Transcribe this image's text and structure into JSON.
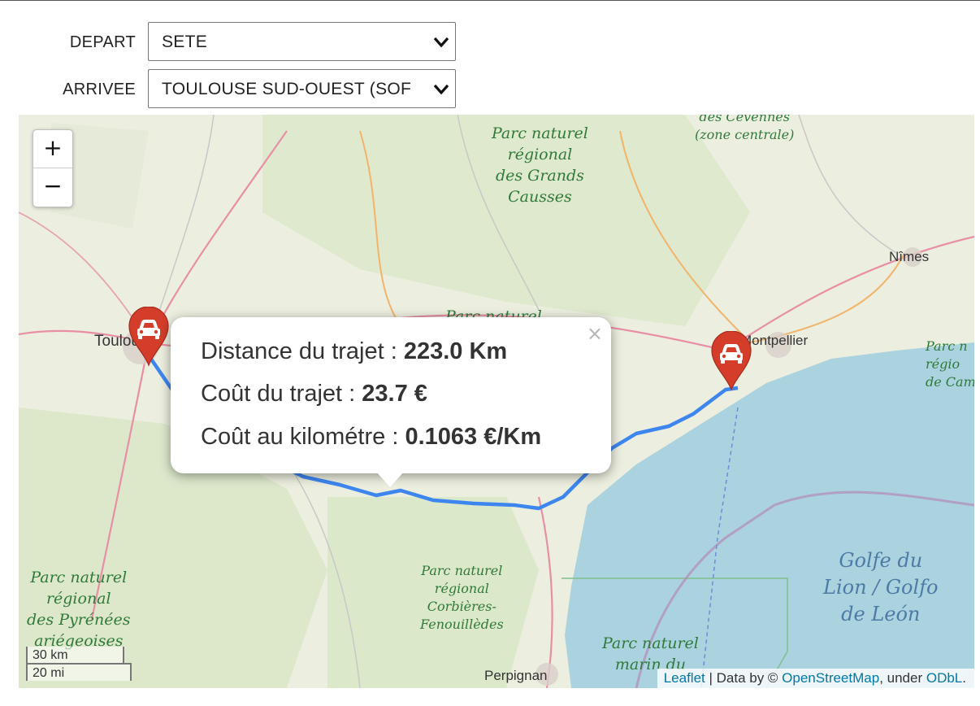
{
  "form": {
    "depart_label": "DEPART",
    "depart_value": "SETE",
    "arrivee_label": "ARRIVEE",
    "arrivee_value": "TOULOUSE SUD-OUEST (SOF"
  },
  "map": {
    "zoom_in": "+",
    "zoom_out": "−",
    "labels": {
      "grands_causses": "Parc naturel\nrégional\ndes Grands\nCausses",
      "cevennes": "des Cévennes\n(zone centrale)",
      "parc_naturel_mid": "Parc naturel",
      "pyrenees": "Parc naturel\nrégional\ndes Pyrénées\nariégeoises",
      "corbieres": "Parc naturel\nrégional\nCorbières-\nFenouillèdes",
      "marin": "Parc naturel\nmarin du",
      "camargue": "Parc n\nrégio\nde Cam",
      "golfe": "Golfe du\nLion / Golfo\nde León"
    },
    "cities": {
      "nimes": "Nîmes",
      "montpellier": "Montpellier",
      "toulouse": "Toulouse",
      "perpignan": "Perpignan"
    },
    "markers": {
      "start_icon": "car-icon",
      "end_icon": "car-icon",
      "color": "#d33d29"
    },
    "route_color": "#3d86f0",
    "popup": {
      "distance_label": "Distance du trajet : ",
      "distance_value": "223.0 Km",
      "cost_label": "Coût du trajet : ",
      "cost_value": "23.7 €",
      "per_km_label": "Coût au kilométre : ",
      "per_km_value": "0.1063 €/Km",
      "close": "×"
    },
    "scale": {
      "metric": "30 km",
      "imperial": "20 mi"
    },
    "attribution": {
      "leaflet": "Leaflet",
      "sep": " | Data by © ",
      "osm": "OpenStreetMap",
      "under": ", under ",
      "odbl": "ODbL",
      "end": "."
    }
  }
}
